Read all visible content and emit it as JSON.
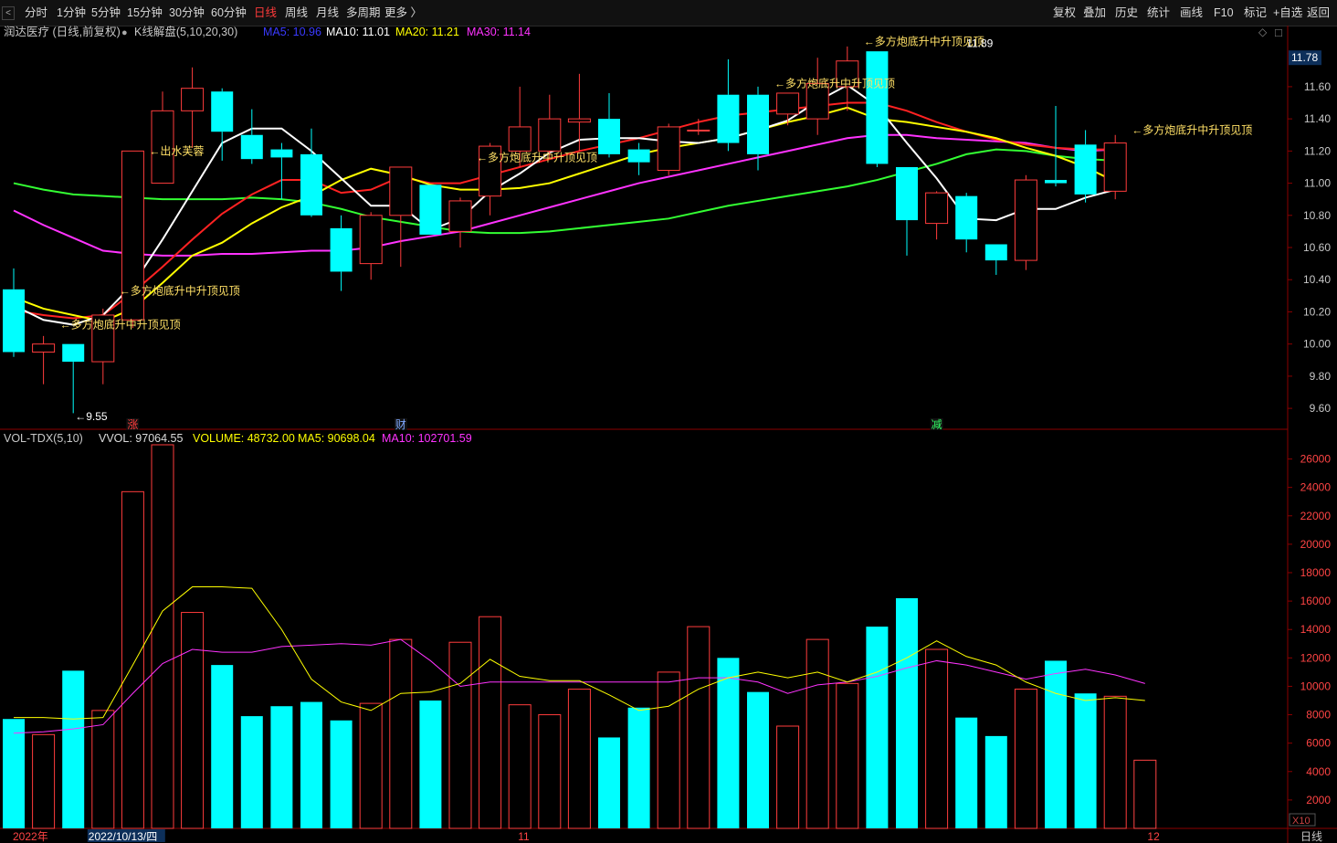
{
  "toolbar": {
    "periods": [
      "分时",
      "1分钟",
      "5分钟",
      "15分钟",
      "30分钟",
      "60分钟",
      "日线",
      "周线",
      "月线",
      "多周期",
      "更多 〉"
    ],
    "active": "日线",
    "actions": [
      "复权",
      "叠加",
      "历史",
      "统计",
      "画线",
      "F10",
      "标记",
      "+自选",
      "返回"
    ]
  },
  "info": {
    "stock": "润达医疗 (日线,前复权)",
    "indicator": "K线解盘(5,10,20,30)",
    "ma": [
      {
        "label": "MA5: 10.96",
        "color": "#3a3aff"
      },
      {
        "label": "MA10: 11.01",
        "color": "#ffffff"
      },
      {
        "label": "MA20: 11.21",
        "color": "#ffff00"
      },
      {
        "label": "MA30: 11.14",
        "color": "#ff33ff"
      }
    ]
  },
  "vol_info": {
    "indicator": "VOL-TDX(5,10)",
    "items": [
      {
        "label": "VVOL: 97064.55",
        "color": "#dddddd"
      },
      {
        "label": "VOLUME: 48732.00",
        "color": "#ffff00"
      },
      {
        "label": "MA5: 90698.04",
        "color": "#ffff00"
      },
      {
        "label": "MA10: 102701.59",
        "color": "#ff33ff"
      }
    ]
  },
  "colors": {
    "up": "#ff3c3c",
    "down": "#00ffff",
    "ma5": "#ffffff",
    "ma10": "#ffff00",
    "ma20": "#ff3333",
    "ma30": "#ff33ff",
    "ma60": "#33ff33",
    "grid": "#8b0000",
    "text": "#c8c8c8"
  },
  "chart_data": {
    "type": "candlestick",
    "price_ticks": [
      "11.60",
      "11.40",
      "11.20",
      "11.00",
      "10.80",
      "10.60",
      "10.40",
      "10.20",
      "10.00",
      "9.80",
      "9.60"
    ],
    "price_range": [
      9.47,
      11.98
    ],
    "current_price": "11.78",
    "volume_ticks": [
      "26000",
      "24000",
      "22000",
      "20000",
      "18000",
      "16000",
      "14000",
      "12000",
      "10000",
      "8000",
      "6000",
      "4000",
      "2000"
    ],
    "volume_range": [
      0,
      27000
    ],
    "volume_unit": "X10",
    "candles": [
      {
        "o": 10.34,
        "h": 10.47,
        "l": 9.92,
        "c": 9.95
      },
      {
        "o": 9.95,
        "h": 10.05,
        "l": 9.75,
        "c": 10.0
      },
      {
        "o": 10.0,
        "h": 10.0,
        "l": 9.57,
        "c": 9.89
      },
      {
        "o": 9.89,
        "h": 10.22,
        "l": 9.75,
        "c": 10.18
      },
      {
        "o": 10.15,
        "h": 11.2,
        "l": 10.1,
        "c": 11.2
      },
      {
        "o": 11.0,
        "h": 11.57,
        "l": 11.0,
        "c": 11.45
      },
      {
        "o": 11.45,
        "h": 11.72,
        "l": 11.22,
        "c": 11.59
      },
      {
        "o": 11.57,
        "h": 11.59,
        "l": 11.14,
        "c": 11.32
      },
      {
        "o": 11.3,
        "h": 11.46,
        "l": 11.12,
        "c": 11.15
      },
      {
        "o": 11.21,
        "h": 11.25,
        "l": 10.9,
        "c": 11.16
      },
      {
        "o": 11.18,
        "h": 11.34,
        "l": 10.79,
        "c": 10.8
      },
      {
        "o": 10.72,
        "h": 10.8,
        "l": 10.33,
        "c": 10.45
      },
      {
        "o": 10.5,
        "h": 10.82,
        "l": 10.4,
        "c": 10.8
      },
      {
        "o": 10.8,
        "h": 11.1,
        "l": 10.48,
        "c": 11.1
      },
      {
        "o": 10.99,
        "h": 10.99,
        "l": 10.68,
        "c": 10.68
      },
      {
        "o": 10.7,
        "h": 10.91,
        "l": 10.6,
        "c": 10.89
      },
      {
        "o": 10.92,
        "h": 11.25,
        "l": 10.8,
        "c": 11.23
      },
      {
        "o": 11.2,
        "h": 11.6,
        "l": 11.1,
        "c": 11.35
      },
      {
        "o": 11.2,
        "h": 11.55,
        "l": 11.15,
        "c": 11.4
      },
      {
        "o": 11.38,
        "h": 11.68,
        "l": 11.2,
        "c": 11.4
      },
      {
        "o": 11.4,
        "h": 11.56,
        "l": 11.16,
        "c": 11.18
      },
      {
        "o": 11.21,
        "h": 11.25,
        "l": 11.05,
        "c": 11.13
      },
      {
        "o": 11.08,
        "h": 11.37,
        "l": 11.05,
        "c": 11.35
      },
      {
        "o": 11.33,
        "h": 11.4,
        "l": 11.3,
        "c": 11.33
      },
      {
        "o": 11.55,
        "h": 11.77,
        "l": 11.2,
        "c": 11.25
      },
      {
        "o": 11.55,
        "h": 11.6,
        "l": 11.08,
        "c": 11.18
      },
      {
        "o": 11.43,
        "h": 11.56,
        "l": 11.36,
        "c": 11.56
      },
      {
        "o": 11.4,
        "h": 11.78,
        "l": 11.3,
        "c": 11.62
      },
      {
        "o": 11.6,
        "h": 11.85,
        "l": 11.45,
        "c": 11.76
      },
      {
        "o": 11.82,
        "h": 11.82,
        "l": 11.1,
        "c": 11.12
      },
      {
        "o": 11.1,
        "h": 11.1,
        "l": 10.55,
        "c": 10.77
      },
      {
        "o": 10.75,
        "h": 10.95,
        "l": 10.65,
        "c": 10.94
      },
      {
        "o": 10.92,
        "h": 10.94,
        "l": 10.57,
        "c": 10.65
      },
      {
        "o": 10.62,
        "h": 10.62,
        "l": 10.43,
        "c": 10.52
      },
      {
        "o": 10.52,
        "h": 11.05,
        "l": 10.46,
        "c": 11.02
      },
      {
        "o": 11.02,
        "h": 11.48,
        "l": 10.98,
        "c": 11.0
      },
      {
        "o": 11.24,
        "h": 11.33,
        "l": 10.88,
        "c": 10.93
      },
      {
        "o": 10.95,
        "h": 11.3,
        "l": 10.9,
        "c": 11.25
      }
    ],
    "volumes": [
      7700,
      6600,
      11100,
      8300,
      23700,
      27000,
      15200,
      11500,
      7900,
      8600,
      8900,
      7600,
      8800,
      13300,
      9000,
      13100,
      14900,
      8700,
      8000,
      9800,
      6400,
      8500,
      11000,
      14200,
      12000,
      9600,
      7200,
      13300,
      10200,
      14200,
      16200,
      12600,
      7800,
      6500,
      9800,
      11800,
      9500,
      9300,
      4800
    ],
    "vol_ma5": [
      7800,
      7800,
      7700,
      7800,
      11500,
      15300,
      17000,
      17000,
      16900,
      14000,
      10500,
      8900,
      8300,
      9500,
      9600,
      10200,
      11900,
      10700,
      10400,
      10400,
      9400,
      8300,
      8600,
      9800,
      10600,
      11000,
      10600,
      11000,
      10300,
      11000,
      12000,
      13200,
      12100,
      11500,
      10300,
      9500,
      9000,
      9200,
      9000
    ],
    "vol_ma10": [
      6700,
      6800,
      7000,
      7300,
      9500,
      11600,
      12600,
      12400,
      12400,
      12800,
      12900,
      13000,
      12900,
      13300,
      11800,
      10000,
      10300,
      10300,
      10300,
      10300,
      10300,
      10300,
      10300,
      10600,
      10600,
      10300,
      9500,
      10100,
      10300,
      10700,
      11300,
      11800,
      11500,
      11000,
      10500,
      10900,
      11200,
      10800,
      10200
    ],
    "ma_white": [
      10.24,
      10.15,
      10.12,
      10.18,
      10.37,
      10.65,
      10.95,
      11.25,
      11.34,
      11.34,
      11.2,
      11.03,
      10.86,
      10.86,
      10.71,
      10.78,
      10.95,
      11.06,
      11.19,
      11.27,
      11.28,
      11.28,
      11.26,
      11.25,
      11.28,
      11.33,
      11.39,
      11.51,
      11.61,
      11.48,
      11.25,
      11.03,
      10.78,
      10.77,
      10.84,
      10.84,
      10.91,
      10.96
    ],
    "ma_yellow": [
      10.29,
      10.22,
      10.18,
      10.14,
      10.22,
      10.38,
      10.55,
      10.63,
      10.75,
      10.85,
      10.92,
      11.02,
      11.09,
      11.05,
      10.99,
      10.96,
      10.96,
      10.97,
      11.0,
      11.06,
      11.12,
      11.18,
      11.22,
      11.25,
      11.28,
      11.33,
      11.38,
      11.42,
      11.47,
      11.4,
      11.38,
      11.35,
      11.32,
      11.28,
      11.22,
      11.17,
      11.1,
      11.01
    ],
    "ma_red": [
      10.21,
      10.18,
      10.16,
      10.18,
      10.32,
      10.48,
      10.65,
      10.81,
      10.93,
      11.02,
      11.02,
      10.94,
      10.96,
      11.04,
      11.0,
      11.0,
      11.05,
      11.1,
      11.15,
      11.2,
      11.24,
      11.28,
      11.33,
      11.38,
      11.42,
      11.44,
      11.46,
      11.48,
      11.5,
      11.5,
      11.45,
      11.38,
      11.32,
      11.27,
      11.24,
      11.22,
      11.21,
      11.21
    ],
    "ma_magenta": [
      10.83,
      10.74,
      10.66,
      10.58,
      10.56,
      10.55,
      10.55,
      10.56,
      10.56,
      10.57,
      10.58,
      10.58,
      10.6,
      10.64,
      10.67,
      10.7,
      10.75,
      10.8,
      10.85,
      10.9,
      10.95,
      11.0,
      11.04,
      11.08,
      11.12,
      11.16,
      11.2,
      11.24,
      11.28,
      11.3,
      11.3,
      11.28,
      11.27,
      11.26,
      11.25,
      11.22,
      11.2,
      11.21
    ],
    "ma_green": [
      11.0,
      10.96,
      10.93,
      10.92,
      10.91,
      10.9,
      10.9,
      10.9,
      10.91,
      10.9,
      10.88,
      10.84,
      10.79,
      10.76,
      10.73,
      10.7,
      10.69,
      10.69,
      10.7,
      10.72,
      10.74,
      10.76,
      10.78,
      10.82,
      10.86,
      10.89,
      10.92,
      10.95,
      10.98,
      11.02,
      11.07,
      11.12,
      11.18,
      11.21,
      11.2,
      11.17,
      11.15,
      11.14
    ],
    "annotations": [
      {
        "bar": 1,
        "price": 10.12,
        "text": "←多方炮底升中升顶见顶"
      },
      {
        "bar": 3,
        "price": 10.33,
        "text": "←多方炮底升中升顶见顶"
      },
      {
        "bar": 4,
        "price": 11.2,
        "text": "←出水芙蓉"
      },
      {
        "bar": 15,
        "price": 11.16,
        "text": "←多方炮底升中升顶见顶"
      },
      {
        "bar": 25,
        "price": 11.62,
        "text": "←多方炮底升中升顶见顶"
      },
      {
        "bar": 28,
        "price": 11.88,
        "text": "←多方炮底升中升顶见顶"
      },
      {
        "bar": 37,
        "price": 11.33,
        "text": "←多方炮底升中升顶见顶"
      }
    ],
    "low_label": "←9.55",
    "high_label": "11.89",
    "event_markers": [
      {
        "bar": 4,
        "text": "涨",
        "color": "#ff3c3c"
      },
      {
        "bar": 13,
        "text": "财",
        "color": "#7fa7ff"
      },
      {
        "bar": 31,
        "text": "减",
        "color": "#33ff66"
      }
    ],
    "date_labels": [
      {
        "bar": 0,
        "text": "2022年",
        "highlight": false
      },
      {
        "bar": 3,
        "text": "2022/10/13/四",
        "highlight": true
      },
      {
        "bar": 17,
        "text": "11",
        "highlight": false
      },
      {
        "bar": 39,
        "text": "12",
        "highlight": false
      }
    ],
    "bottom_right": "日线"
  }
}
